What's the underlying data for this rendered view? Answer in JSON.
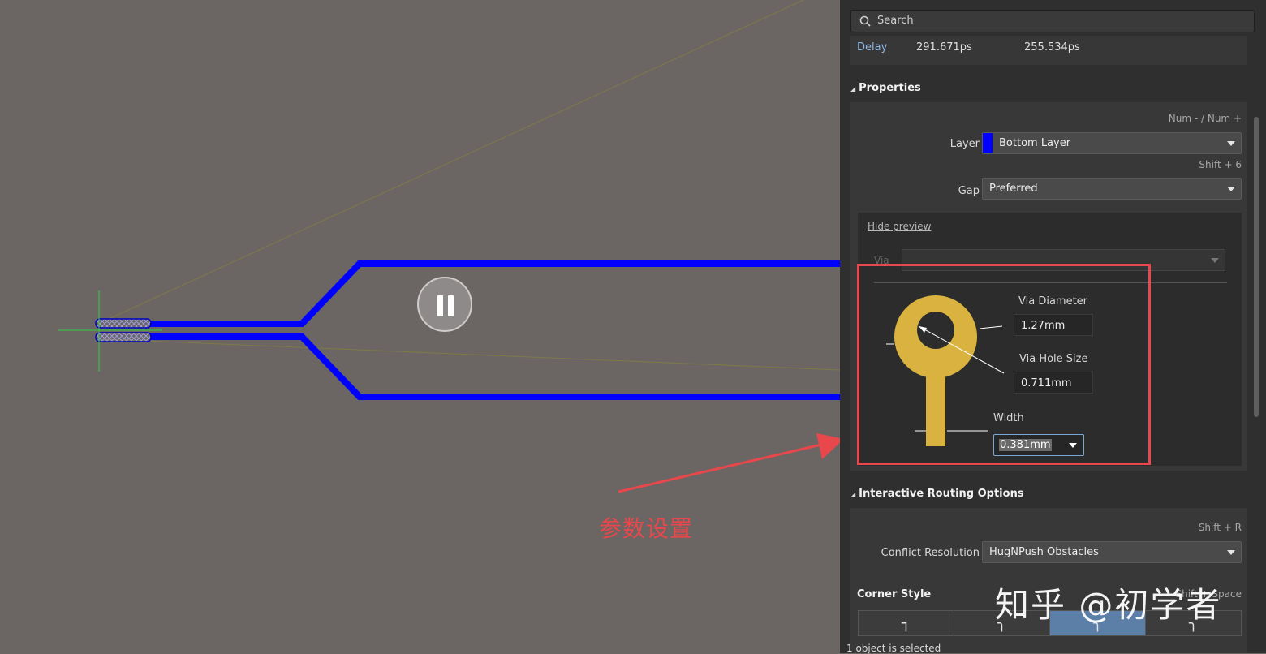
{
  "search": {
    "placeholder": "Search"
  },
  "delay": {
    "label": "Delay",
    "value1": "291.671ps",
    "value2": "255.534ps"
  },
  "properties": {
    "title": "Properties",
    "layer_hint": "Num - / Num +",
    "layer_label": "Layer",
    "layer_value": "Bottom Layer",
    "layer_color": "#0000ff",
    "gap_hint": "Shift + 6",
    "gap_label": "Gap",
    "gap_value": "Preferred",
    "hide_preview": "Hide preview",
    "via_label": "Via",
    "via_diameter_label": "Via Diameter",
    "via_diameter_value": "1.27mm",
    "via_hole_label": "Via Hole Size",
    "via_hole_value": "0.711mm",
    "width_label": "Width",
    "width_value": "0.381mm"
  },
  "routing": {
    "title": "Interactive Routing Options",
    "conflict_hint": "Shift + R",
    "conflict_label": "Conflict Resolution",
    "conflict_value": "HugNPush Obstacles",
    "corner_label": "Corner Style",
    "corner_hint": "Shift + Space",
    "corner_options": [
      "┐",
      "╮",
      "╮",
      "╮"
    ]
  },
  "status": "1 object is selected",
  "annotation": "参数设置",
  "watermark": "知乎 @初学者",
  "colors": {
    "trace": "#0000ff",
    "via_pad": "#d9b23f",
    "annotation": "#e8474b",
    "active_corner": "#5c7fa8"
  }
}
